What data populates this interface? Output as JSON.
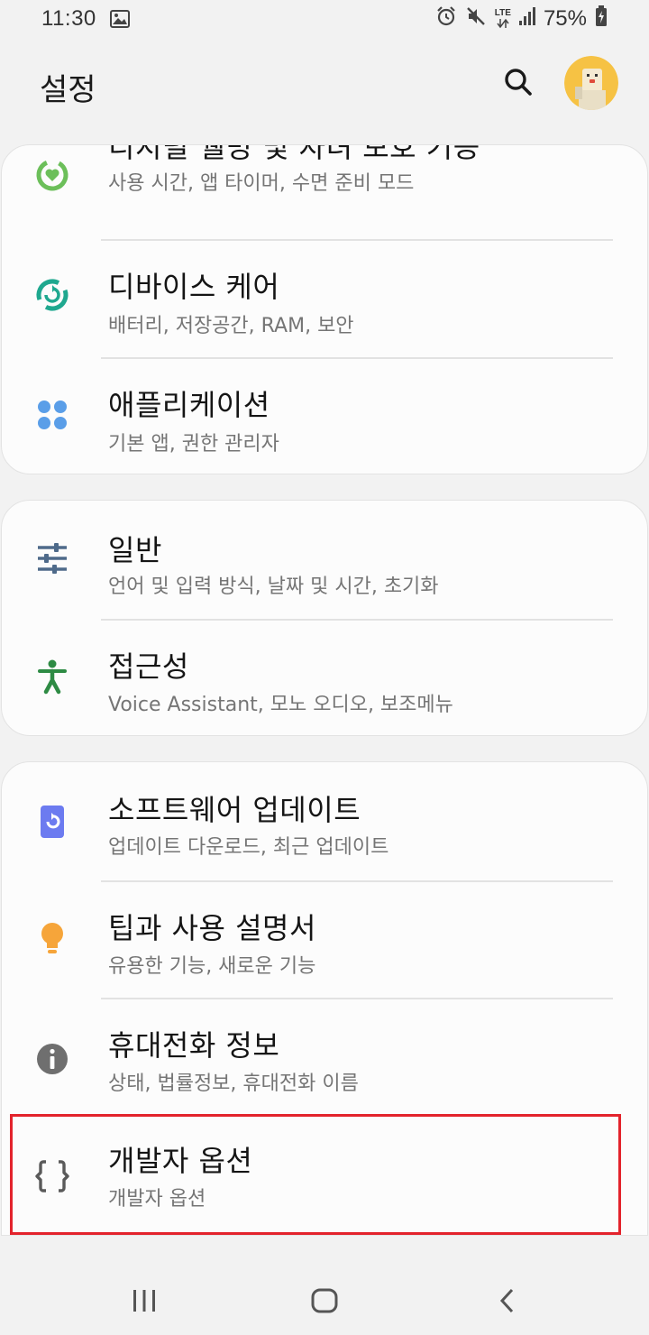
{
  "status_bar": {
    "time": "11:30",
    "lte_label": "LTE",
    "battery": "75%",
    "icons": [
      "image-icon",
      "alarm-icon",
      "mute-icon",
      "lte-icon",
      "signal-icon",
      "battery-charging-icon"
    ]
  },
  "header": {
    "title": "설정",
    "search_icon": "search-icon",
    "avatar_icon": "profile-avatar"
  },
  "sections": [
    {
      "items": [
        {
          "title": "디지털 웰빙 및 자녀 보호 기능",
          "subtitle": "사용 시간, 앱 타이머, 수면 준비 모드",
          "icon": "digital-wellbeing-icon",
          "color": "#6cbf5a"
        },
        {
          "title": "디바이스 케어",
          "subtitle": "배터리, 저장공간, RAM, 보안",
          "icon": "device-care-icon",
          "color": "#1fa88f"
        },
        {
          "title": "애플리케이션",
          "subtitle": "기본 앱, 권한 관리자",
          "icon": "apps-icon",
          "color": "#5a9ee8"
        }
      ]
    },
    {
      "items": [
        {
          "title": "일반",
          "subtitle": "언어 및 입력 방식, 날짜 및 시간, 초기화",
          "icon": "general-sliders-icon",
          "color": "#4e6a8a"
        },
        {
          "title": "접근성",
          "subtitle": "Voice Assistant, 모노 오디오, 보조메뉴",
          "icon": "accessibility-icon",
          "color": "#2e8b44"
        }
      ]
    },
    {
      "items": [
        {
          "title": "소프트웨어 업데이트",
          "subtitle": "업데이트 다운로드, 최근 업데이트",
          "icon": "software-update-icon",
          "color": "#6c7bf0"
        },
        {
          "title": "팁과 사용 설명서",
          "subtitle": "유용한 기능, 새로운 기능",
          "icon": "tips-bulb-icon",
          "color": "#f6a53a"
        },
        {
          "title": "휴대전화 정보",
          "subtitle": "상태, 법률정보, 휴대전화 이름",
          "icon": "info-icon",
          "color": "#6f6f6f"
        },
        {
          "title": "개발자 옵션",
          "subtitle": "개발자 옵션",
          "icon": "developer-braces-icon",
          "color": "#5a5a5a",
          "highlighted": true
        }
      ]
    }
  ],
  "highlight_color": "#e3232c",
  "nav_bar": {
    "buttons": [
      "recent-apps-icon",
      "home-icon",
      "back-icon"
    ]
  }
}
